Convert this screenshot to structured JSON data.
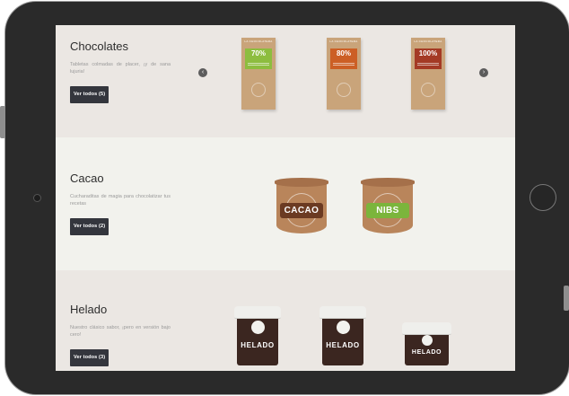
{
  "sections": [
    {
      "title": "Chocolates",
      "description": "Tabletas colmadas de placer, ¡y de sana lujuria!",
      "button": "Ver todos (5)",
      "products": [
        {
          "brand": "LA CHOCOLATERA",
          "label": "70%",
          "color": "#8dbd3f"
        },
        {
          "brand": "LA CHOCOLATERA",
          "label": "80%",
          "color": "#cc5f25"
        },
        {
          "brand": "LA CHOCOLATERA",
          "label": "100%",
          "color": "#a43a25"
        }
      ]
    },
    {
      "title": "Cacao",
      "description": "Cucharaditas de magia para chocolatizar tus recetas",
      "button": "Ver todos (2)",
      "products": [
        {
          "label": "CACAO",
          "color": "#6b3a22"
        },
        {
          "label": "NIBS",
          "color": "#7bb53c"
        }
      ]
    },
    {
      "title": "Helado",
      "description": "Nuestro clásico sabor, ¡pero en versión bajo cero!",
      "button": "Ver todos (3)",
      "products": [
        {
          "label": "HELADO"
        },
        {
          "label": "HELADO"
        },
        {
          "label": "HELADO"
        }
      ]
    }
  ],
  "carousel": {
    "prev_icon": "chevron-left-icon",
    "next_icon": "chevron-right-icon"
  }
}
